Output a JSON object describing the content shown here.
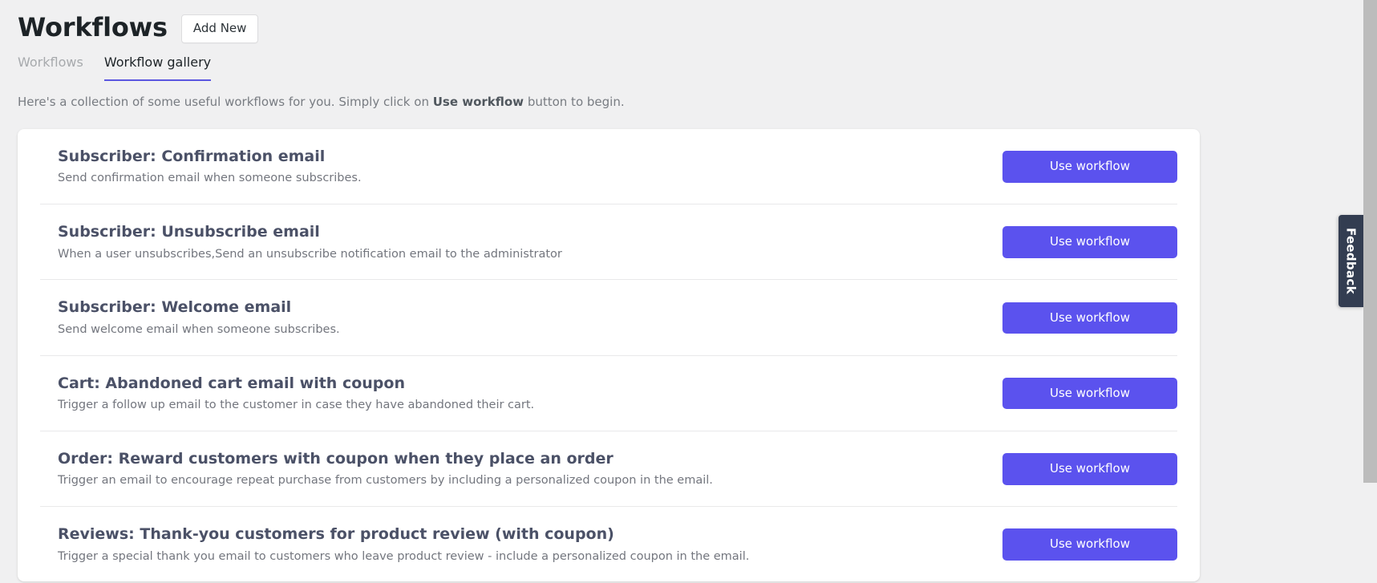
{
  "header": {
    "title": "Workflows",
    "add_new_label": "Add New"
  },
  "tabs": [
    {
      "label": "Workflows",
      "active": false
    },
    {
      "label": "Workflow gallery",
      "active": true
    }
  ],
  "intro": {
    "before": "Here's a collection of some useful workflows for you. Simply click on ",
    "emphasis": "Use workflow",
    "after": " button to begin."
  },
  "workflows": [
    {
      "title": "Subscriber: Confirmation email",
      "description": "Send confirmation email when someone subscribes.",
      "action_label": "Use workflow"
    },
    {
      "title": "Subscriber: Unsubscribe email",
      "description": "When a user unsubscribes,Send an unsubscribe notification email to the administrator",
      "action_label": "Use workflow"
    },
    {
      "title": "Subscriber: Welcome email",
      "description": "Send welcome email when someone subscribes.",
      "action_label": "Use workflow"
    },
    {
      "title": "Cart: Abandoned cart email with coupon",
      "description": "Trigger a follow up email to the customer in case they have abandoned their cart.",
      "action_label": "Use workflow"
    },
    {
      "title": "Order: Reward customers with coupon when they place an order",
      "description": "Trigger an email to encourage repeat purchase from customers by including a personalized coupon in the email.",
      "action_label": "Use workflow"
    },
    {
      "title": "Reviews: Thank-you customers for product review (with coupon)",
      "description": "Trigger a special thank you email to customers who leave product review - include a personalized coupon in the email.",
      "action_label": "Use workflow"
    }
  ],
  "feedback": {
    "label": "Feedback"
  },
  "colors": {
    "accent": "#5b52ee",
    "tab_underline": "#5b57e0",
    "page_background": "#f0f0f1",
    "card_background": "#ffffff",
    "title_text": "#1d2327",
    "muted_text": "#787c82",
    "feedback_background": "#333d51"
  }
}
